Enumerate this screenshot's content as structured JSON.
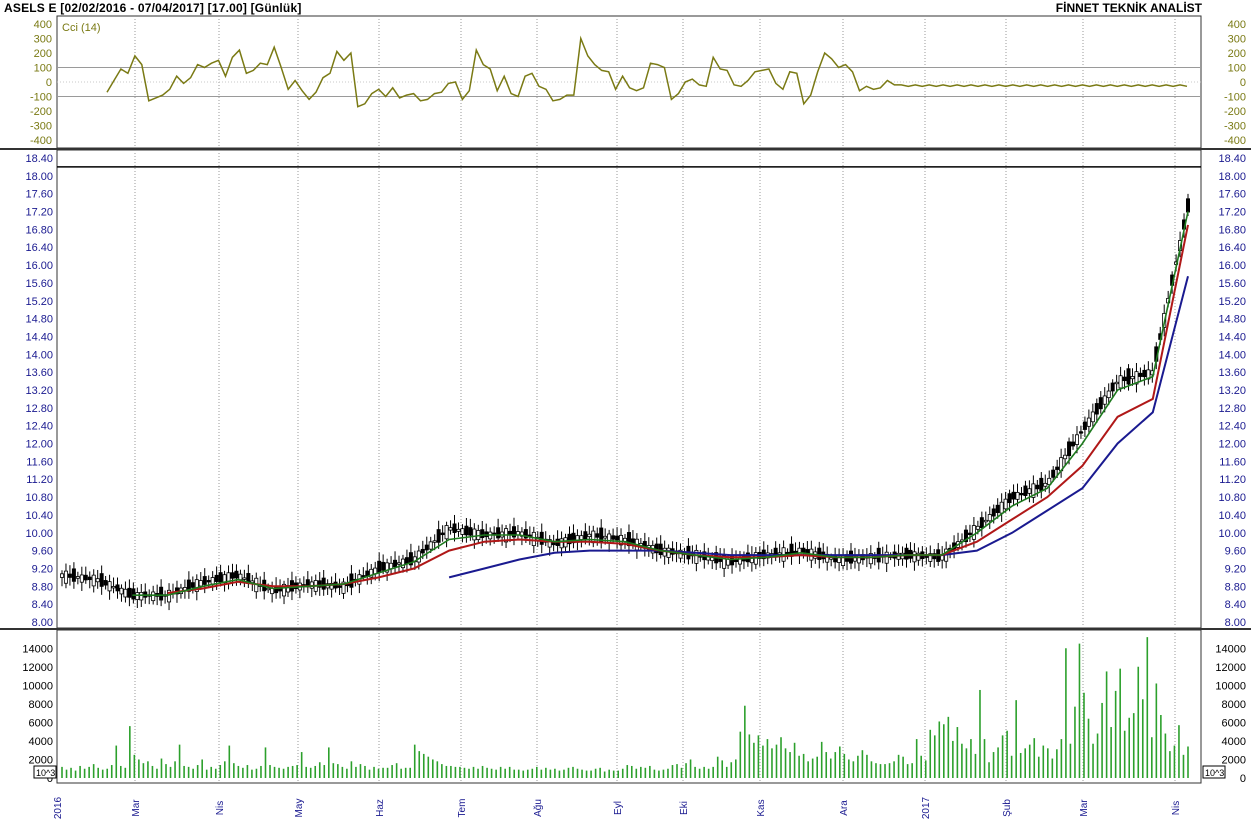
{
  "header": {
    "symbol": "ASELS E",
    "range": "[02/02/2016 - 07/04/2017]",
    "last": "[17.00]",
    "period": "[Günlük]",
    "source": "FİNNET TEKNİK ANALİST"
  },
  "colors": {
    "cci": "#7a7a14",
    "ma_short": "#1e7a1e",
    "ma_mid": "#b01818",
    "ma_long": "#1a1a90",
    "volume": "#2ca02c",
    "up_candle": "#ffffff",
    "down_candle": "#000000",
    "tick_label": "#1a1a90",
    "volume_tick": "#000000"
  },
  "chart_data": [
    {
      "type": "line",
      "name": "cci",
      "legend": "Cci (14)",
      "ylim": [
        -400,
        400
      ],
      "yticks": [
        "400",
        "300",
        "200",
        "100",
        "0",
        "-100",
        "-200",
        "-300",
        "-400"
      ],
      "reference_lines": [
        100,
        -100
      ],
      "x": [
        8,
        10,
        12,
        14,
        16,
        18,
        20,
        22,
        24,
        26,
        28,
        30,
        32,
        34,
        36,
        38,
        40,
        42,
        44,
        46,
        48,
        50,
        52,
        54,
        56,
        58,
        60,
        62,
        64,
        66,
        68,
        70,
        72,
        74,
        76,
        78,
        80,
        82,
        84,
        86,
        88,
        90,
        92,
        94,
        96,
        98,
        100,
        102,
        104,
        106,
        108,
        110,
        112,
        114,
        116,
        118,
        120,
        122,
        124,
        126,
        128,
        130,
        132,
        134,
        136,
        138,
        140,
        142,
        144,
        146,
        148,
        150,
        152,
        154,
        156,
        158,
        160,
        162,
        164,
        166,
        168,
        170,
        172,
        174,
        176,
        178,
        180,
        182,
        184,
        186,
        188,
        190,
        192,
        194,
        196,
        198,
        200,
        202,
        204,
        206,
        208,
        210,
        212,
        214,
        216,
        218,
        220,
        222,
        224,
        226,
        228,
        230,
        232,
        234,
        236,
        238,
        240,
        242,
        244,
        246,
        248,
        250,
        252,
        254,
        256,
        258,
        260,
        262,
        264,
        266,
        268,
        270,
        272,
        274,
        276,
        278,
        280,
        282,
        284,
        286,
        288,
        290,
        292,
        294,
        296,
        298,
        300,
        302,
        304,
        306,
        308,
        310,
        312,
        314,
        316,
        318,
        320
      ],
      "y": [
        -70,
        10,
        90,
        60,
        180,
        120,
        -130,
        -110,
        -90,
        -50,
        40,
        -10,
        30,
        120,
        100,
        130,
        150,
        40,
        170,
        220,
        60,
        80,
        130,
        120,
        240,
        100,
        -50,
        10,
        -60,
        -120,
        -70,
        30,
        60,
        210,
        150,
        200,
        -170,
        -150,
        -80,
        -50,
        -100,
        -40,
        -110,
        -90,
        -80,
        -130,
        -120,
        -80,
        -70,
        -10,
        0,
        -120,
        -60,
        220,
        120,
        90,
        -60,
        40,
        -80,
        -100,
        40,
        60,
        -30,
        -50,
        -130,
        -120,
        -90,
        -90,
        300,
        180,
        120,
        80,
        70,
        -50,
        40,
        -40,
        -60,
        -40,
        130,
        120,
        100,
        -120,
        -80,
        0,
        20,
        -20,
        -30,
        170,
        90,
        80,
        -20,
        -30,
        10,
        70,
        80,
        90,
        -10,
        -50,
        70,
        60,
        -150,
        -90,
        70,
        200,
        160,
        100,
        120,
        70,
        -60,
        -30,
        -50,
        -40,
        10,
        -20,
        -20,
        -30,
        -20,
        -30,
        -20,
        -30,
        -20,
        -30,
        -20,
        -30,
        -20,
        -30,
        -20,
        -30,
        -20,
        -30,
        -20,
        -30,
        -20,
        -30,
        -20,
        -30,
        -20,
        -30,
        -20,
        -30,
        -20,
        -30,
        -20,
        -30,
        -20,
        -30,
        -20,
        -30,
        -20,
        -30,
        -20,
        -30,
        -20,
        -30,
        -20,
        -30
      ]
    },
    {
      "type": "line",
      "name": "price",
      "ylim": [
        8.0,
        18.4
      ],
      "yticks": [
        "18.40",
        "18.00",
        "17.60",
        "17.20",
        "16.80",
        "16.40",
        "16.00",
        "15.60",
        "15.20",
        "14.80",
        "14.40",
        "14.00",
        "13.60",
        "13.20",
        "12.80",
        "12.40",
        "12.00",
        "11.60",
        "11.20",
        "10.80",
        "10.40",
        "10.00",
        "9.60",
        "9.20",
        "8.80",
        "8.40",
        "8.00"
      ],
      "reference_line": 18.2,
      "x": [
        0,
        10,
        20,
        30,
        40,
        50,
        60,
        70,
        80,
        90,
        100,
        110,
        120,
        130,
        140,
        150,
        160,
        170,
        180,
        190,
        200,
        210,
        220,
        230,
        240,
        250,
        260,
        270,
        280,
        290,
        300,
        310,
        320
      ],
      "close": [
        9.05,
        8.95,
        8.6,
        8.6,
        8.9,
        9.05,
        8.7,
        8.85,
        8.8,
        9.2,
        9.4,
        10.1,
        9.95,
        10.0,
        9.75,
        9.95,
        9.85,
        9.6,
        9.5,
        9.35,
        9.5,
        9.6,
        9.4,
        9.45,
        9.5,
        9.45,
        10.1,
        10.8,
        11.1,
        12.3,
        13.4,
        13.6,
        17.3
      ],
      "ma_short": [
        null,
        null,
        8.6,
        8.6,
        8.8,
        8.95,
        8.75,
        8.8,
        8.85,
        9.1,
        9.35,
        9.85,
        9.95,
        9.95,
        9.8,
        9.85,
        9.8,
        9.6,
        9.5,
        9.4,
        9.45,
        9.55,
        9.45,
        9.45,
        9.5,
        9.5,
        10.0,
        10.6,
        11.0,
        12.0,
        13.2,
        13.5,
        17.2
      ],
      "ma_mid": [
        null,
        null,
        null,
        8.65,
        8.75,
        8.9,
        8.8,
        8.8,
        8.85,
        9.0,
        9.2,
        9.6,
        9.8,
        9.85,
        9.8,
        9.8,
        9.75,
        9.6,
        9.5,
        9.45,
        9.45,
        9.5,
        9.45,
        9.45,
        9.5,
        9.5,
        9.8,
        10.3,
        10.8,
        11.5,
        12.6,
        13.0,
        16.9
      ],
      "ma_long": [
        null,
        null,
        null,
        null,
        null,
        null,
        null,
        null,
        null,
        null,
        null,
        9.0,
        9.2,
        9.4,
        9.55,
        9.6,
        9.6,
        9.6,
        9.55,
        9.5,
        9.5,
        9.5,
        9.5,
        9.5,
        9.5,
        9.5,
        9.6,
        10.0,
        10.5,
        11.0,
        12.0,
        12.7,
        15.75
      ]
    },
    {
      "type": "bar",
      "name": "volume",
      "unit": "10^3",
      "ylim": [
        0,
        15000
      ],
      "yticks": [
        "14000",
        "12000",
        "10000",
        "8000",
        "6000",
        "4000",
        "2000",
        "0"
      ],
      "values": [
        1200,
        900,
        1100,
        800,
        1300,
        1000,
        1200,
        1500,
        1100,
        900,
        1000,
        1400,
        3500,
        1300,
        1100,
        5600,
        2500,
        2000,
        1600,
        1800,
        1300,
        1000,
        2100,
        1500,
        1200,
        1800,
        3600,
        1300,
        1200,
        1000,
        1400,
        2000,
        900,
        1200,
        1000,
        1400,
        1800,
        3500,
        1600,
        1300,
        1100,
        1400,
        900,
        1000,
        1300,
        3300,
        1400,
        1200,
        1100,
        1000,
        1200,
        1300,
        1400,
        2800,
        1200,
        1100,
        1300,
        1700,
        1400,
        3300,
        1600,
        1500,
        1200,
        1000,
        1800,
        1200,
        1500,
        1300,
        900,
        1200,
        1000,
        1100,
        1100,
        1400,
        1600,
        1000,
        1100,
        1100,
        3600,
        2900,
        2600,
        2300,
        2000,
        1800,
        1500,
        1300,
        1300,
        1200,
        1200,
        1100,
        1000,
        1200,
        1000,
        1300,
        1100,
        1000,
        900,
        1200,
        1000,
        1200,
        900,
        900,
        800,
        900,
        1000,
        1200,
        900,
        1100,
        900,
        1000,
        800,
        900,
        1100,
        1200,
        1000,
        900,
        800,
        800,
        1000,
        1100,
        700,
        900,
        800,
        800,
        1000,
        1400,
        1300,
        1000,
        1200,
        1100,
        1300,
        900,
        800,
        900,
        1000,
        1400,
        1500,
        1100,
        1600,
        2000,
        1200,
        1000,
        1200,
        1000,
        1200,
        2300,
        1900,
        1200,
        1700,
        2000,
        5000,
        7800,
        4700,
        3800,
        4600,
        3500,
        4200,
        3200,
        3600,
        4400,
        3200,
        2800,
        3800,
        2400,
        2600,
        1800,
        2100,
        2300,
        3900,
        2800,
        2100,
        2800,
        3400,
        2600,
        2000,
        1800,
        2400,
        3000,
        2500,
        1800,
        1600,
        1500,
        1500,
        1600,
        1800,
        2500,
        2300,
        1500,
        1600,
        4200,
        2400,
        1900,
        5200,
        4600,
        6100,
        5800,
        6600,
        4000,
        5500,
        3700,
        3200,
        4200,
        2600,
        9500,
        4200,
        1700,
        2800,
        3300,
        4600,
        5100,
        2400,
        8400,
        2700,
        3200,
        3600,
        4300,
        2300,
        3500,
        3200,
        2100,
        3100,
        4200,
        14000,
        3700,
        7700,
        14500,
        9200,
        6400,
        3700,
        4800,
        8100,
        11500,
        5500,
        9400,
        11800,
        5100,
        6500,
        7000,
        12000,
        8500,
        15200,
        4400,
        10200,
        6800,
        4800,
        2900,
        3500,
        5700,
        2500,
        3400
      ],
      "bar_count": 225
    }
  ],
  "axes": {
    "x_labels": [
      "2016",
      "Mar",
      "Nis",
      "May",
      "Haz",
      "Tem",
      "Ağu",
      "Eyl",
      "Eki",
      "Kas",
      "Ara",
      "2017",
      "Şub",
      "Mar",
      "Nis"
    ],
    "volume_unit_left": "10^3",
    "volume_unit_right": "10^3"
  }
}
